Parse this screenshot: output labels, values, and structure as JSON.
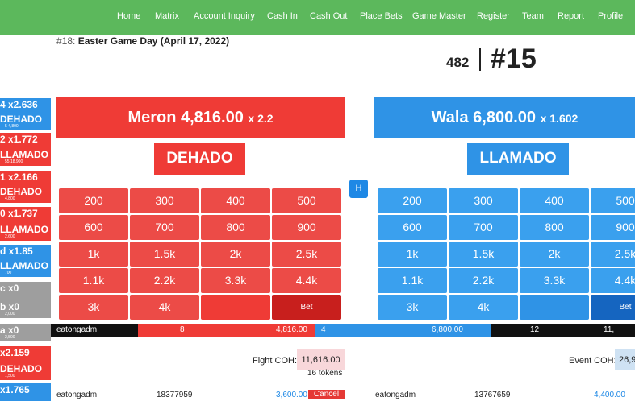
{
  "nav": [
    "Home",
    "Matrix",
    "Account Inquiry",
    "Cash In",
    "Cash Out",
    "Place Bets",
    "Game Master",
    "Register",
    "Team",
    "Report",
    "Profile"
  ],
  "event": {
    "number": "#18:",
    "title": "Easter Game Day (April 17, 2022)"
  },
  "counter": {
    "count": "482",
    "fight": "#15"
  },
  "history": [
    {
      "big": "4 x2.636",
      "small": "",
      "color": "blue"
    },
    {
      "big": "DEHADO",
      "small": "5    4,800",
      "color": "blue"
    },
    {
      "big": "2 x1.772",
      "small": "",
      "color": "red"
    },
    {
      "big": "LLAMADO",
      "small": "55    18,900",
      "color": "red"
    },
    {
      "big": "1 x2.166",
      "small": "",
      "color": "red"
    },
    {
      "big": "DEHADO",
      "small": "4,800",
      "color": "red"
    },
    {
      "big": "0 x1.737",
      "small": "",
      "color": "red"
    },
    {
      "big": "LLAMADO",
      "small": "2,600",
      "color": "red"
    },
    {
      "big": "d x1.85",
      "small": "",
      "color": "blue"
    },
    {
      "big": "LLAMADO",
      "small": "700",
      "color": "blue"
    },
    {
      "big": "c x0",
      "small": "",
      "color": "gray"
    },
    {
      "big": "b x0",
      "small": "2,000",
      "color": "gray"
    },
    {
      "big": "a x0",
      "small": "2,500",
      "color": "gray"
    },
    {
      "big": "x2.159",
      "small": "",
      "color": "red"
    },
    {
      "big": "DEHADO",
      "small": "1,500",
      "color": "red"
    },
    {
      "big": "x1.765",
      "small": "",
      "color": "blue"
    }
  ],
  "meron": {
    "label": "Meron 4,816.00",
    "mult": "x 2.2",
    "tag": "DEHADO",
    "chips": [
      "200",
      "300",
      "400",
      "500",
      "600",
      "700",
      "800",
      "900",
      "1k",
      "1.5k",
      "2k",
      "2.5k",
      "1.1k",
      "2.2k",
      "3.3k",
      "4.4k",
      "3k",
      "4k",
      "",
      "Bet"
    ]
  },
  "wala": {
    "label": "Wala 6,800.00",
    "mult": "x 1.602",
    "tag": "LLAMADO",
    "chips": [
      "200",
      "300",
      "400",
      "500",
      "600",
      "700",
      "800",
      "900",
      "1k",
      "1.5k",
      "2k",
      "2.5k",
      "1.1k",
      "2.2k",
      "3.3k",
      "4.4k",
      "3k",
      "4k",
      "",
      "Bet"
    ]
  },
  "h_button": "H",
  "totals": {
    "user": "eatongadm",
    "meron_count": "8",
    "meron_total": "4,816.00",
    "wala_count": "4",
    "wala_total": "6,800.00",
    "right_count": "12",
    "right_total": "11,"
  },
  "footer": {
    "fight_coh_label": "Fight COH:",
    "fight_coh_value": "11,616.00",
    "tokens": "16 tokens",
    "event_coh_label": "Event COH:",
    "event_coh_value": "26,9",
    "row_left": {
      "user": "eatongadm",
      "ref": "18377959",
      "amount": "3,600.00",
      "cancel": "Cancel"
    },
    "row_right": {
      "user": "eatongadm",
      "ref": "13767659",
      "amount": "4,400.00"
    }
  },
  "colors": {
    "nav": "#5cb85c",
    "meron": "#ef3b36",
    "wala": "#2f93e6"
  }
}
